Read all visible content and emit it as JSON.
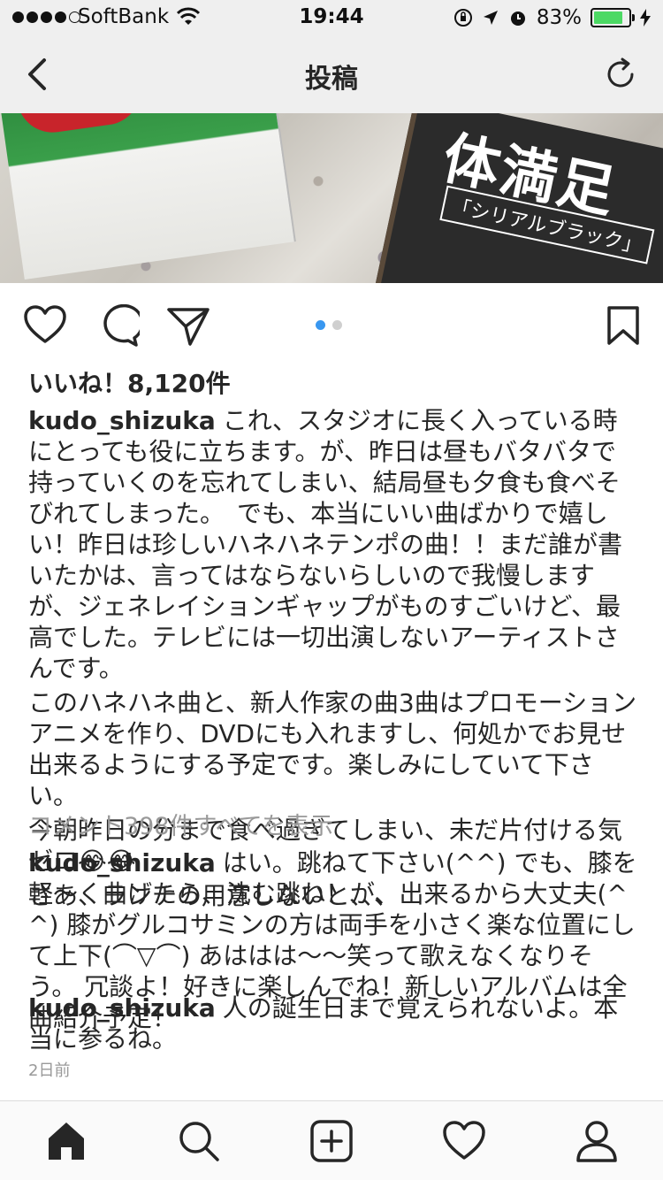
{
  "status_bar": {
    "carrier": "SoftBank",
    "time": "19:44",
    "battery_percent": "83%",
    "battery_level": 0.83
  },
  "nav": {
    "title": "投稿"
  },
  "photo": {
    "product_text": "体満足",
    "product_sub": "「シリアルブラック」"
  },
  "post": {
    "likes": "いいね！8,120件",
    "username": "kudo_shizuka",
    "caption": [
      "これ、スタジオに長く入っている時にとっても役に立ちます。が、昨日は昼もバタバタで持っていくのを忘れてしまい、結局昼も夕食も食べそびれてしまった。　でも、本当にいい曲ばかりで嬉しい！昨日は珍しいハネハネテンポの曲！！まだ誰が書いたかは、言ってはならないらしいので我慢しますが、ジェネレイションギャップがものすごいけど、最高でした。テレビには一切出演しないアーティストさんです。",
      "このハネハネ曲と、新人作家の曲3曲はプロモーションアニメを作り、DVDにも入れますし、何処かでお見せ出来るようにする予定です。楽しみにしていて下さい。",
      "今朝昨日の分まで食べ過ぎてしまい、未だ片付ける気ゼロ😂😂",
      "さあ、ランチの用意しないと、、、"
    ],
    "view_comments": "コメント398件すべてを表示",
    "comments": [
      {
        "user": "kudo_shizuka",
        "text": "はい。跳ねて下さい(^^) でも、膝を軽〜く曲げたら、沈む跳ね！が、出来るから大丈夫(^^) 膝がグルコサミンの方は両手を小さく楽な位置にして上下(⌒▽⌒) あははは〜〜笑って歌えなくなりそう。 冗談よ！好きに楽しんでね！新しいアルバムは全曲紹介予定！"
      },
      {
        "user": "kudo_shizuka",
        "text": "人の誕生日まで覚えられないよ。本当に参るね。"
      }
    ],
    "timestamp": "2日前"
  },
  "icons": {
    "back": "chevron-left-icon",
    "refresh": "refresh-icon",
    "like": "heart-icon",
    "comment": "comment-icon",
    "share": "send-icon",
    "save": "bookmark-icon",
    "tab_home": "home-icon",
    "tab_search": "search-icon",
    "tab_add": "add-icon",
    "tab_activity": "heart-icon",
    "tab_profile": "profile-icon"
  },
  "colors": {
    "accent": "#3897f0",
    "battery": "#4cd964",
    "secondary_text": "#999999"
  }
}
